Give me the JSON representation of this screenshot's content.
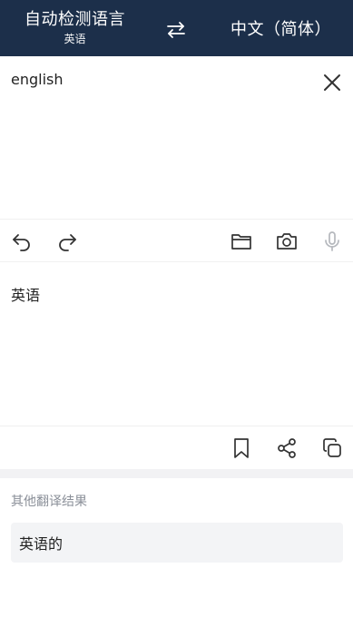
{
  "header": {
    "source_lang": "自动检测语言",
    "detected_lang": "英语",
    "target_lang": "中文（简体）",
    "swap_icon": "swap-arrows-icon"
  },
  "input": {
    "value": "english",
    "clear_icon": "close-icon"
  },
  "input_toolbar": {
    "icons": [
      "undo-icon",
      "redo-icon",
      "folder-icon",
      "camera-icon",
      "microphone-icon"
    ]
  },
  "output": {
    "text": "英语"
  },
  "output_toolbar": {
    "icons": [
      "bookmark-icon",
      "share-icon",
      "copy-icon"
    ]
  },
  "other_results": {
    "title": "其他翻译结果",
    "items": [
      "英语的"
    ]
  },
  "colors": {
    "header_bg": "#1c2f4a",
    "icon": "#333333",
    "mic_disabled": "#b5b8bd",
    "muted_text": "#8a8f98",
    "result_bg": "#f3f4f6"
  }
}
